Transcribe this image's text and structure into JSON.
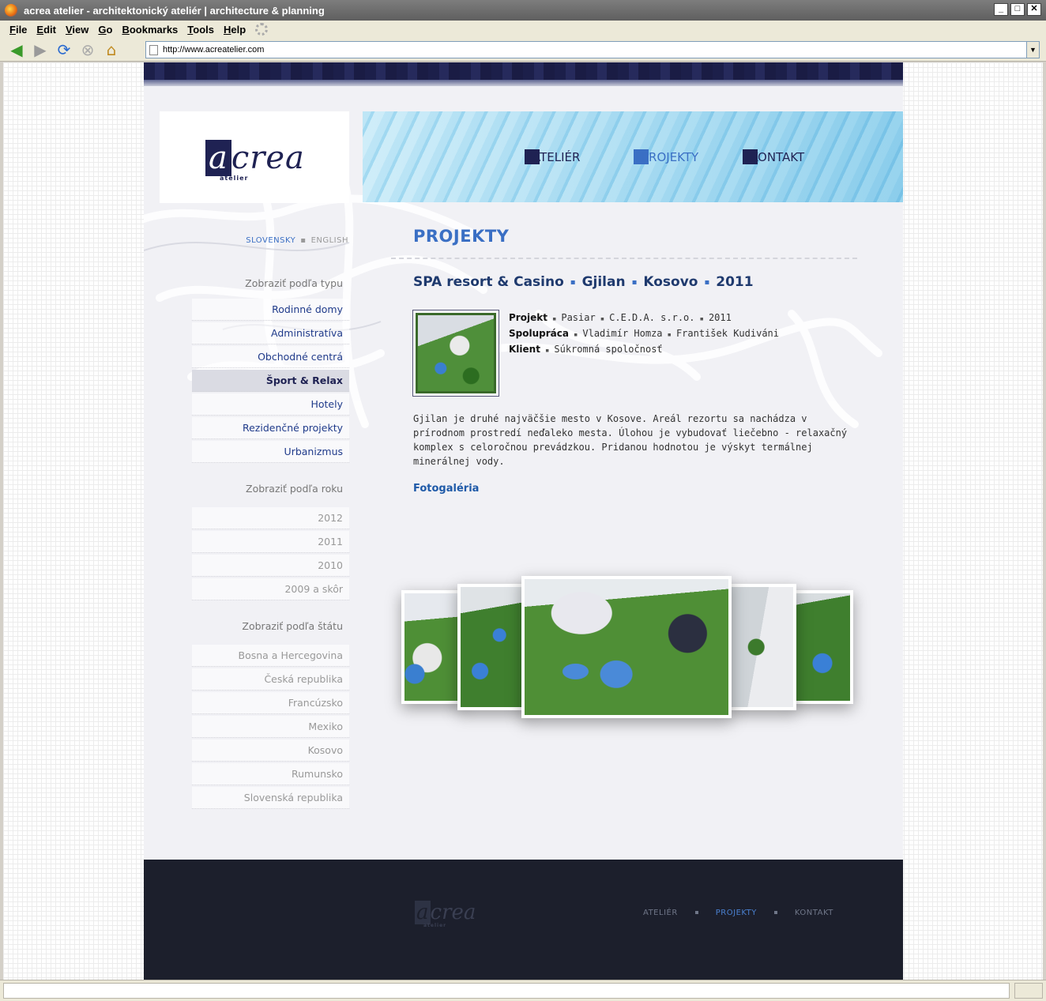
{
  "window": {
    "title": "acrea atelier - architektonický ateliér  |  architecture & planning",
    "buttons": {
      "minimize": "_",
      "maximize": "□",
      "close": "✕"
    }
  },
  "menu": [
    "File",
    "Edit",
    "View",
    "Go",
    "Bookmarks",
    "Tools",
    "Help"
  ],
  "address": {
    "url": "http://www.acreatelier.com"
  },
  "site": {
    "logo": {
      "letter": "a",
      "rest": "crea",
      "sub": "atelier"
    },
    "nav": [
      {
        "label": "ATELIÉR",
        "active": false
      },
      {
        "label": "PROJEKTY",
        "active": true
      },
      {
        "label": "KONTAKT",
        "active": false
      }
    ],
    "lang": {
      "sk": "SLOVENSKY",
      "sep": "▪",
      "en": "ENGLISH"
    },
    "sidebar": {
      "by_type": {
        "heading": "Zobraziť podľa typu",
        "items": [
          "Rodinné domy",
          "Administratíva",
          "Obchodné centrá",
          "Šport & Relax",
          "Hotely",
          "Rezidenčné projekty",
          "Urbanizmus"
        ],
        "active_index": 3
      },
      "by_year": {
        "heading": "Zobraziť podľa roku",
        "items": [
          "2012",
          "2011",
          "2010",
          "2009 a skôr"
        ]
      },
      "by_country": {
        "heading": "Zobraziť podľa štátu",
        "items": [
          "Bosna a Hercegovina",
          "Česká republika",
          "Francúzsko",
          "Mexiko",
          "Kosovo",
          "Rumunsko",
          "Slovenská republika"
        ]
      }
    },
    "main": {
      "title": "PROJEKTY",
      "project_title": [
        "SPA resort & Casino",
        "Gjilan",
        "Kosovo",
        "2011"
      ],
      "title_sep": "▪",
      "meta": {
        "projekt_label": "Projekt",
        "projekt_values": [
          "Pasiar",
          "C.E.D.A. s.r.o.",
          "2011"
        ],
        "spolupraca_label": "Spolupráca",
        "spolupraca_values": [
          "Vladimír Homza",
          "František Kudiváni"
        ],
        "klient_label": "Klient",
        "klient_values": [
          "Súkromná spoločnosť"
        ],
        "sep": "▪"
      },
      "description": "Gjilan je druhé najväčšie mesto v Kosove. Areál rezortu sa nachádza v prírodnom prostredí neďaleko mesta. Úlohou je vybudovať liečebno - relaxačný komplex s celoročnou prevádzkou. Pridanou hodnotou je výskyt termálnej minerálnej vody.",
      "gallery_title": "Fotogaléria"
    },
    "footer": {
      "logo": {
        "letter": "a",
        "rest": "crea",
        "sub": "atelier"
      },
      "nav": [
        {
          "label": "ATELIÉR",
          "active": false
        },
        {
          "label": "PROJEKTY",
          "active": true
        },
        {
          "label": "KONTAKT",
          "active": false
        }
      ]
    }
  },
  "colors": {
    "brand_navy": "#1f2253",
    "accent_blue": "#3a6fc4",
    "footer_bg": "#1c1f2c"
  }
}
